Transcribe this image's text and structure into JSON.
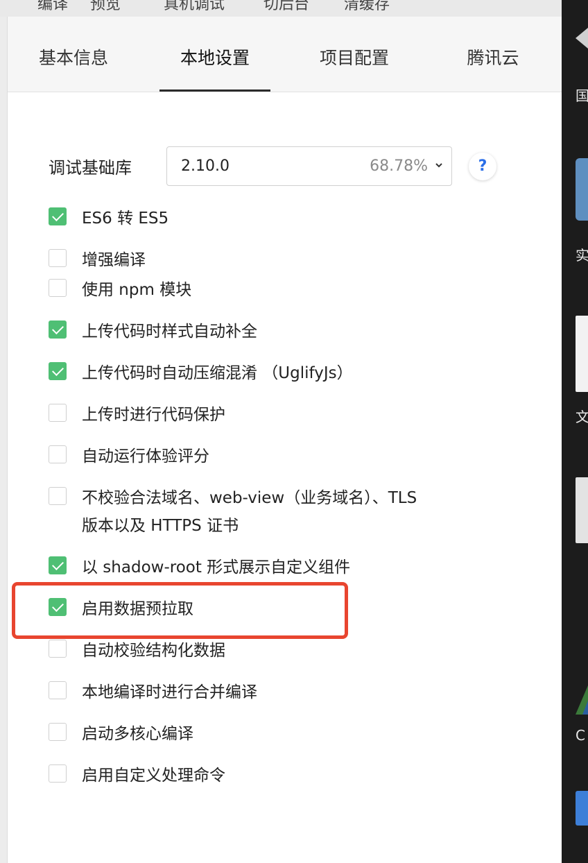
{
  "top_strip": [
    "编译",
    "预览",
    "真机调试",
    "切后台",
    "清缓存"
  ],
  "tabs": [
    {
      "label": "基本信息",
      "active": false
    },
    {
      "label": "本地设置",
      "active": true
    },
    {
      "label": "项目配置",
      "active": false
    },
    {
      "label": "腾讯云",
      "active": false
    }
  ],
  "debug_lib": {
    "label": "调试基础库",
    "version": "2.10.0",
    "percent": "68.78%",
    "help": "?"
  },
  "options": [
    {
      "label": "ES6 转 ES5",
      "checked": true
    },
    {
      "label": "增强编译",
      "checked": false
    },
    {
      "label": "使用 npm 模块",
      "checked": false
    },
    {
      "label": "上传代码时样式自动补全",
      "checked": true
    },
    {
      "label": "上传代码时自动压缩混淆 （UglifyJs）",
      "checked": true
    },
    {
      "label": "上传时进行代码保护",
      "checked": false
    },
    {
      "label": "自动运行体验评分",
      "checked": false
    },
    {
      "label": "不校验合法域名、web-view（业务域名）、TLS",
      "label2": "版本以及 HTTPS 证书",
      "checked": false
    },
    {
      "label": "以 shadow-root 形式展示自定义组件",
      "checked": true
    },
    {
      "label": "启用数据预拉取",
      "checked": true
    },
    {
      "label": "自动校验结构化数据",
      "checked": false
    },
    {
      "label": "本地编译时进行合并编译",
      "checked": false
    },
    {
      "label": "启动多核心编译",
      "checked": false
    },
    {
      "label": "启用自定义处理命令",
      "checked": false
    }
  ],
  "desktop_labels": [
    "国",
    "实",
    "文",
    "C"
  ],
  "colors": {
    "check_green": "#4fbf74",
    "highlight_red": "#e8452f",
    "help_blue": "#2a6ee8"
  }
}
